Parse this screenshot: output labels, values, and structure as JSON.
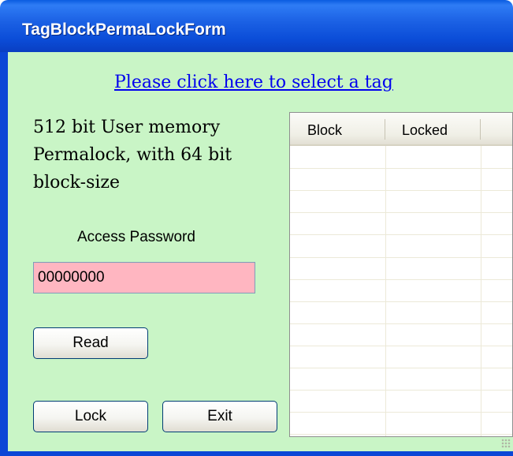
{
  "window": {
    "title": "TagBlockPermaLockForm"
  },
  "form": {
    "select_tag_link": "Please click here to select a tag",
    "description": "512 bit User memory Permalock, with 64 bit block-size",
    "access_password_label": "Access Password",
    "access_password_value": "00000000",
    "read_button": "Read",
    "lock_button": "Lock",
    "exit_button": "Exit"
  },
  "grid": {
    "columns": [
      "Block",
      "Locked"
    ],
    "rows": []
  },
  "colors": {
    "client_background": "#c9f5c6",
    "password_field_background": "#ffb6c1",
    "title_bar": "#0b4dd8",
    "link": "#0000ee"
  }
}
